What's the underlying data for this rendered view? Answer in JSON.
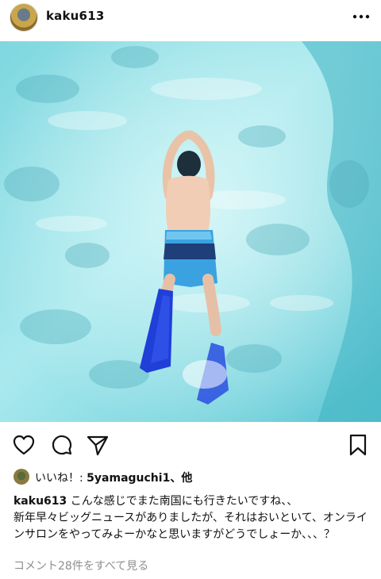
{
  "post": {
    "username": "kaku613",
    "menu_icon": "more-horizontal-icon"
  },
  "actions": {
    "icons": [
      "heart-icon",
      "comment-icon",
      "share-icon",
      "bookmark-icon"
    ]
  },
  "likes": {
    "prefix": "いいね！: ",
    "user": "5yamaguchi1",
    "suffix": "、他"
  },
  "caption": {
    "user": "kaku613",
    "text": "こんな感じでまた南国にも行きたいですね、、\n新年早々ビッグニュースがありましたが、それはおいといて、オンラインサロンをやってみよーかなと思いますがどうでしょーか、、、？"
  },
  "comments": {
    "view_all": "コメント28件をすべて見る"
  },
  "colors": {
    "water_light": "#bfeef2",
    "water_mid": "#6fd0dc",
    "fin_blue": "#1f3fd8"
  }
}
